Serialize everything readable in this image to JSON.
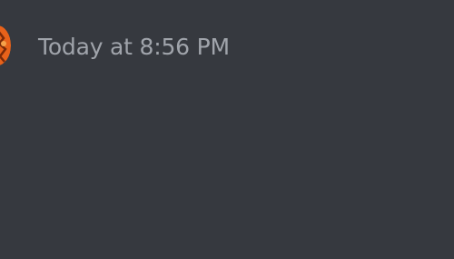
{
  "message": {
    "timestamp": "Today at 8:56 PM",
    "avatar_icon": "orange-creature-avatar-icon"
  },
  "colors": {
    "background": "#36393f",
    "timestamp_text": "#a0a4ab",
    "avatar_primary": "#e8621a",
    "avatar_dark": "#7a2a08"
  }
}
